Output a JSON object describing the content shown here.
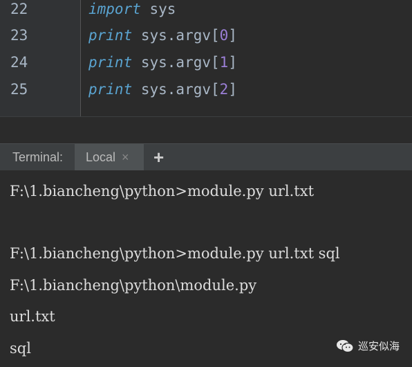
{
  "editor": {
    "lines": [
      {
        "num": "22",
        "kw": "import",
        "rest": " sys",
        "open": "",
        "arg": "",
        "close": ""
      },
      {
        "num": "23",
        "kw": "print",
        "rest": " sys.argv",
        "open": "[",
        "arg": "0",
        "close": "]"
      },
      {
        "num": "24",
        "kw": "print",
        "rest": " sys.argv",
        "open": "[",
        "arg": "1",
        "close": "]"
      },
      {
        "num": "25",
        "kw": "print",
        "rest": " sys.argv",
        "open": "[",
        "arg": "2",
        "close": "]"
      }
    ]
  },
  "terminal": {
    "title": "Terminal:",
    "tab_label": "Local",
    "tab_close": "×",
    "add_label": "+",
    "output": [
      "F:\\1.biancheng\\python>module.py url.txt",
      "",
      "F:\\1.biancheng\\python>module.py url.txt sql",
      "F:\\1.biancheng\\python\\module.py",
      "url.txt",
      "sql"
    ]
  },
  "watermark": {
    "text": "巡安似海",
    "icon": "wechat-icon"
  }
}
